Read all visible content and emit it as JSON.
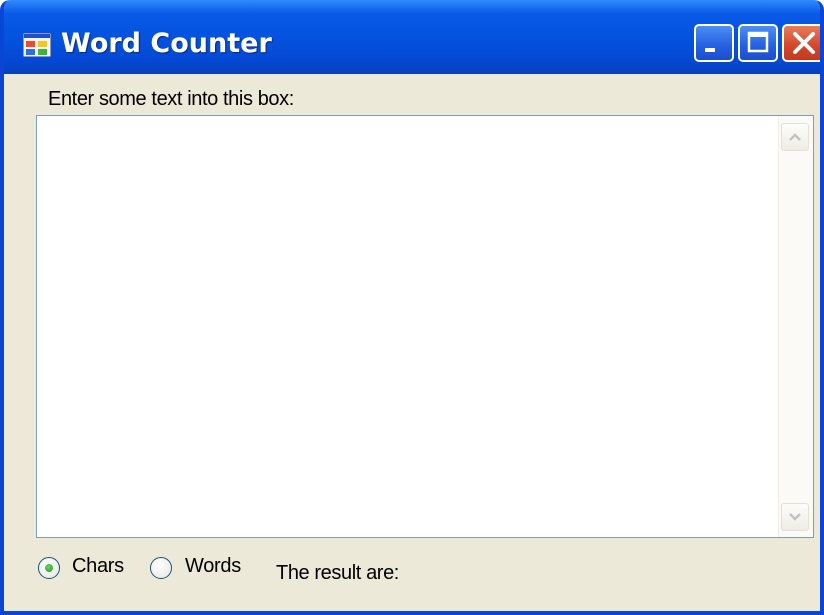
{
  "window": {
    "title": "Word Counter",
    "icon": "app-window-icon",
    "controls": {
      "minimize": "minimize-icon",
      "maximize": "maximize-icon",
      "close": "close-icon"
    }
  },
  "form": {
    "prompt": "Enter some text into this box:",
    "text_value": "",
    "options": [
      {
        "label": "Chars",
        "selected": true
      },
      {
        "label": "Words",
        "selected": false
      }
    ],
    "result_label": "The result are:",
    "result_value": ""
  },
  "colors": {
    "titlebar": "#0453df",
    "window_body": "#ece9d8",
    "close_button": "#d2472a",
    "radio_dot": "#1c9a1c"
  }
}
